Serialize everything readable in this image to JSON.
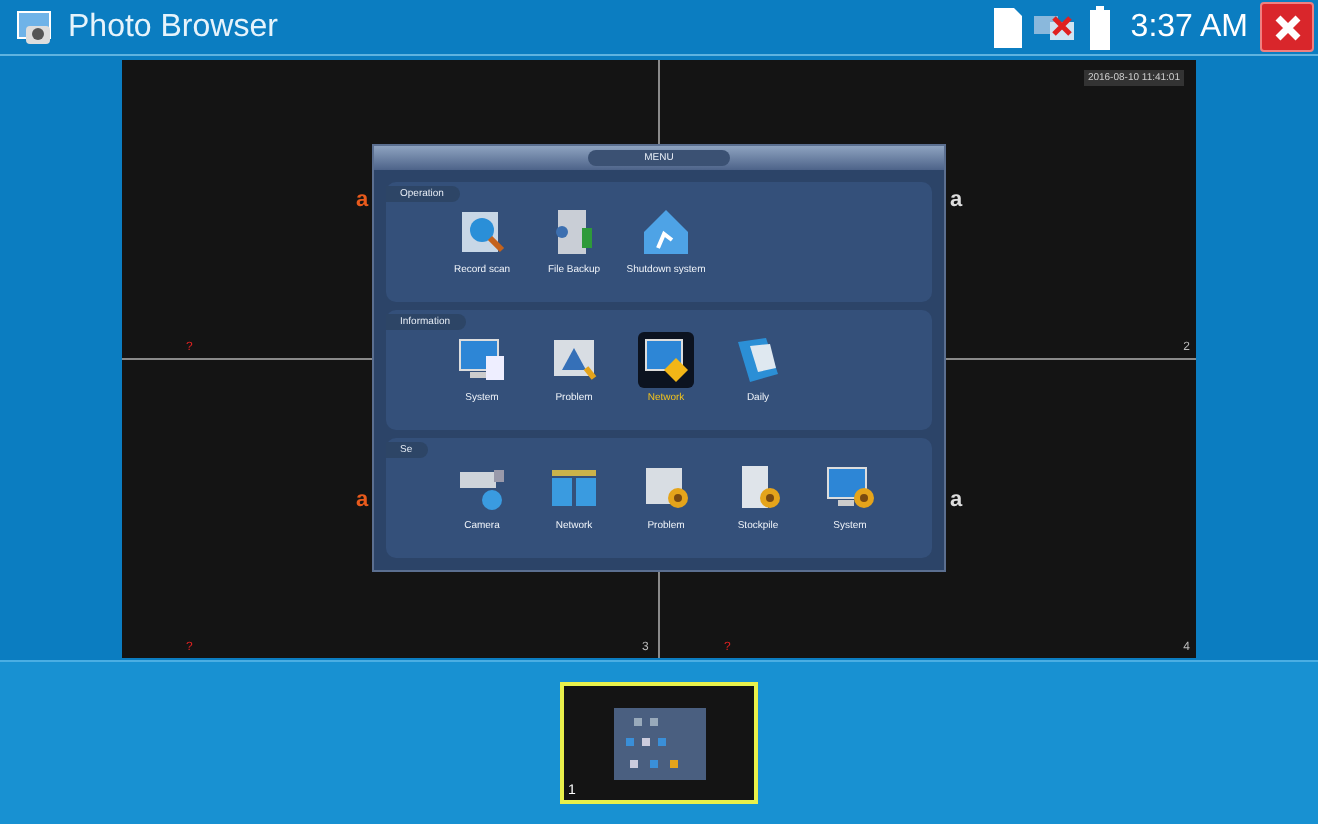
{
  "header": {
    "title": "Photo Browser",
    "time": "3:37 AM"
  },
  "photo": {
    "timestamp": "2016-08-10 11:41:01",
    "quadrants": [
      {
        "mark": "?",
        "logo": "a"
      },
      {
        "number": "2",
        "logo": "a"
      },
      {
        "mark": "?",
        "logo": "a"
      },
      {
        "mark": "?",
        "number": "4",
        "logo": "a"
      }
    ],
    "center_number": "3",
    "menu": {
      "title": "MENU",
      "sections": [
        {
          "title": "Operation",
          "items": [
            {
              "label": "Record scan",
              "kind": "record",
              "selected": false
            },
            {
              "label": "File Backup",
              "kind": "backup",
              "selected": false
            },
            {
              "label": "Shutdown system",
              "kind": "shutdown",
              "selected": false
            }
          ]
        },
        {
          "title": "Information",
          "items": [
            {
              "label": "System",
              "kind": "monitor",
              "selected": false
            },
            {
              "label": "Problem",
              "kind": "warning",
              "selected": false
            },
            {
              "label": "Network",
              "kind": "netinfo",
              "selected": true
            },
            {
              "label": "Daily",
              "kind": "book",
              "selected": false
            }
          ]
        },
        {
          "title": "Se",
          "items": [
            {
              "label": "Camera",
              "kind": "camera",
              "selected": false
            },
            {
              "label": "Network",
              "kind": "network",
              "selected": false
            },
            {
              "label": "Problem",
              "kind": "problemgear",
              "selected": false
            },
            {
              "label": "Stockpile",
              "kind": "stockpile",
              "selected": false
            },
            {
              "label": "System",
              "kind": "monitorgear",
              "selected": false
            }
          ]
        }
      ]
    }
  },
  "thumbnails": [
    {
      "label": "1",
      "selected": true
    }
  ]
}
